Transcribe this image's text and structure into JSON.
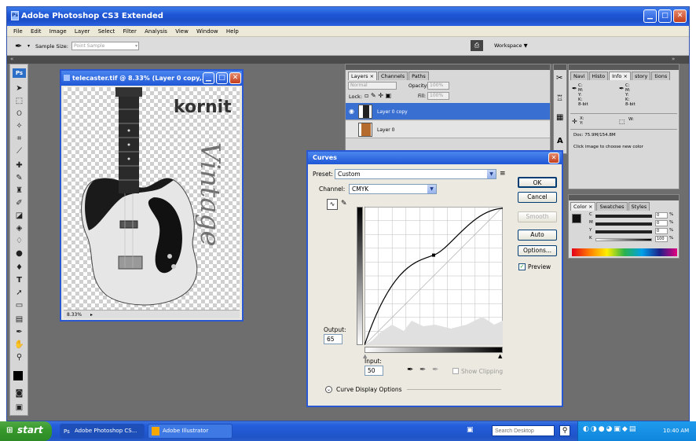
{
  "window": {
    "title": "Adobe Photoshop CS3 Extended"
  },
  "menu": [
    "File",
    "Edit",
    "Image",
    "Layer",
    "Select",
    "Filter",
    "Analysis",
    "View",
    "Window",
    "Help"
  ],
  "options_bar": {
    "sample_size_label": "Sample Size:",
    "sample_size_value": "Point Sample",
    "workspace_label": "Workspace ▼"
  },
  "toolbox": {
    "logo": "Ps"
  },
  "document": {
    "title": "telecaster.tif @ 8.33% (Layer 0 copy,...",
    "zoom": "8.33%",
    "brand_text": "kornit",
    "script_text": "Vintage"
  },
  "layers_panel": {
    "tabs": [
      "Layers ×",
      "Channels",
      "Paths"
    ],
    "blend_mode": "Normal",
    "opacity_label": "Opacity:",
    "opacity_value": "100%",
    "lock_label": "Lock:",
    "fill_label": "Fill:",
    "fill_value": "100%",
    "layers": [
      "Layer 0 copy",
      "Layer 0"
    ]
  },
  "info_panel": {
    "tabs": [
      "Navi",
      "Histo",
      "Info ×",
      "story",
      "tions"
    ],
    "cmyk_left": [
      "C:",
      "M:",
      "Y:",
      "K:"
    ],
    "xy_left": [
      "X:",
      "Y:"
    ],
    "size_label": "W:",
    "doc_text": "Doc: 75.9M/154.8M",
    "hint_text": "Click image to choose new color",
    "bit_left": "8-bit",
    "bit_right": "8-bit"
  },
  "color_panel": {
    "tabs": [
      "Color ×",
      "Swatches",
      "Styles"
    ],
    "channels": [
      "C",
      "M",
      "Y",
      "K"
    ],
    "values": [
      "0",
      "0",
      "0",
      "100"
    ],
    "unit": "%"
  },
  "curves": {
    "title": "Curves",
    "preset_label": "Preset:",
    "preset_value": "Custom",
    "channel_label": "Channel:",
    "channel_value": "CMYK",
    "output_label": "Output:",
    "output_value": "65",
    "input_label": "Input:",
    "input_value": "50",
    "show_clipping": "Show Clipping",
    "display_options": "Curve Display Options",
    "buttons": {
      "ok": "OK",
      "cancel": "Cancel",
      "smooth": "Smooth",
      "auto": "Auto",
      "options": "Options..."
    },
    "preview_label": "Preview",
    "control_point": {
      "input": 50,
      "output": 65
    }
  },
  "taskbar": {
    "start": "start",
    "tasks": [
      "Adobe Photoshop CS...",
      "Adobe Illustrator"
    ],
    "search_placeholder": "Search Desktop",
    "clock": "10:40 AM"
  }
}
